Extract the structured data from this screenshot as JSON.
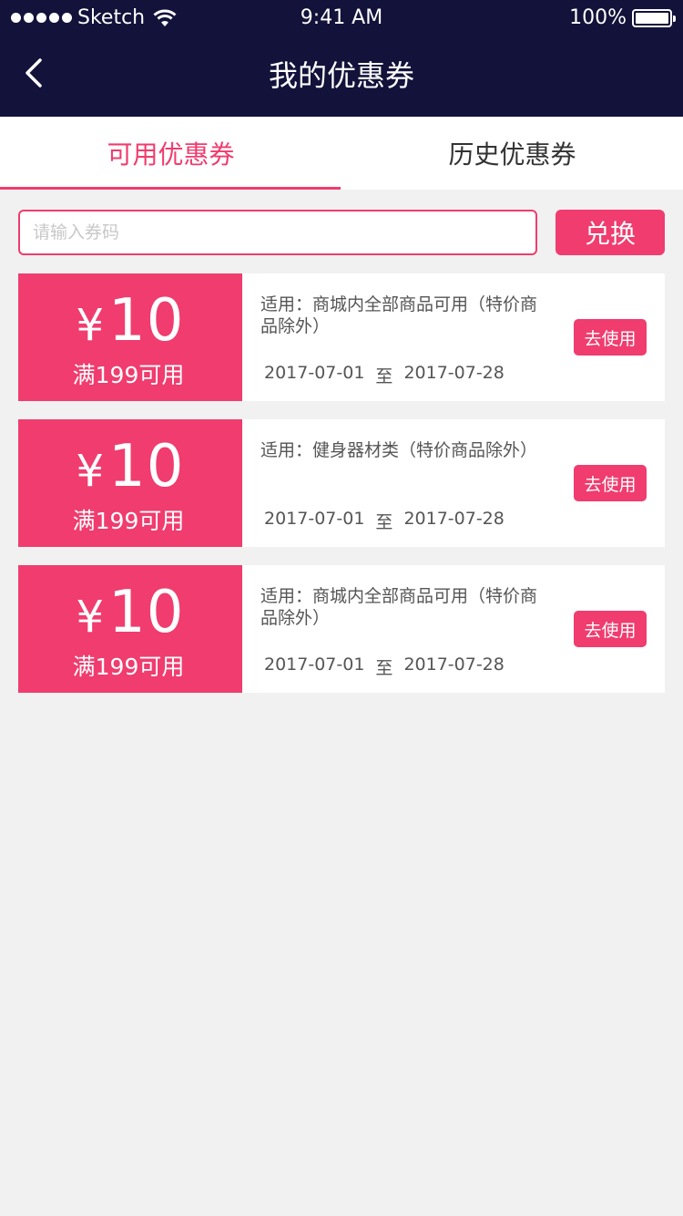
{
  "status_bar": {
    "carrier": "Sketch",
    "time": "9:41 AM",
    "battery": "100%"
  },
  "nav": {
    "title": "我的优惠券",
    "back_icon": "chevron-left-icon"
  },
  "tabs": [
    {
      "label": "可用优惠券",
      "active": true
    },
    {
      "label": "历史优惠券",
      "active": false
    }
  ],
  "redeem": {
    "placeholder": "请输入券码",
    "value": "",
    "button_label": "兑换"
  },
  "coupons": [
    {
      "currency": "¥",
      "amount": "10",
      "condition": "满199可用",
      "scope": "适用：商城内全部商品可用（特价商品除外）",
      "start_date": "2017-07-01",
      "separator": "至",
      "end_date": "2017-07-28",
      "button_label": "去使用"
    },
    {
      "currency": "¥",
      "amount": "10",
      "condition": "满199可用",
      "scope": "适用：健身器材类（特价商品除外）",
      "start_date": "2017-07-01",
      "separator": "至",
      "end_date": "2017-07-28",
      "button_label": "去使用"
    },
    {
      "currency": "¥",
      "amount": "10",
      "condition": "满199可用",
      "scope": "适用：商城内全部商品可用（特价商品除外）",
      "start_date": "2017-07-01",
      "separator": "至",
      "end_date": "2017-07-28",
      "button_label": "去使用"
    }
  ],
  "colors": {
    "header_bg": "#12123a",
    "accent": "#f03c6e",
    "page_bg": "#f1f1f1"
  }
}
